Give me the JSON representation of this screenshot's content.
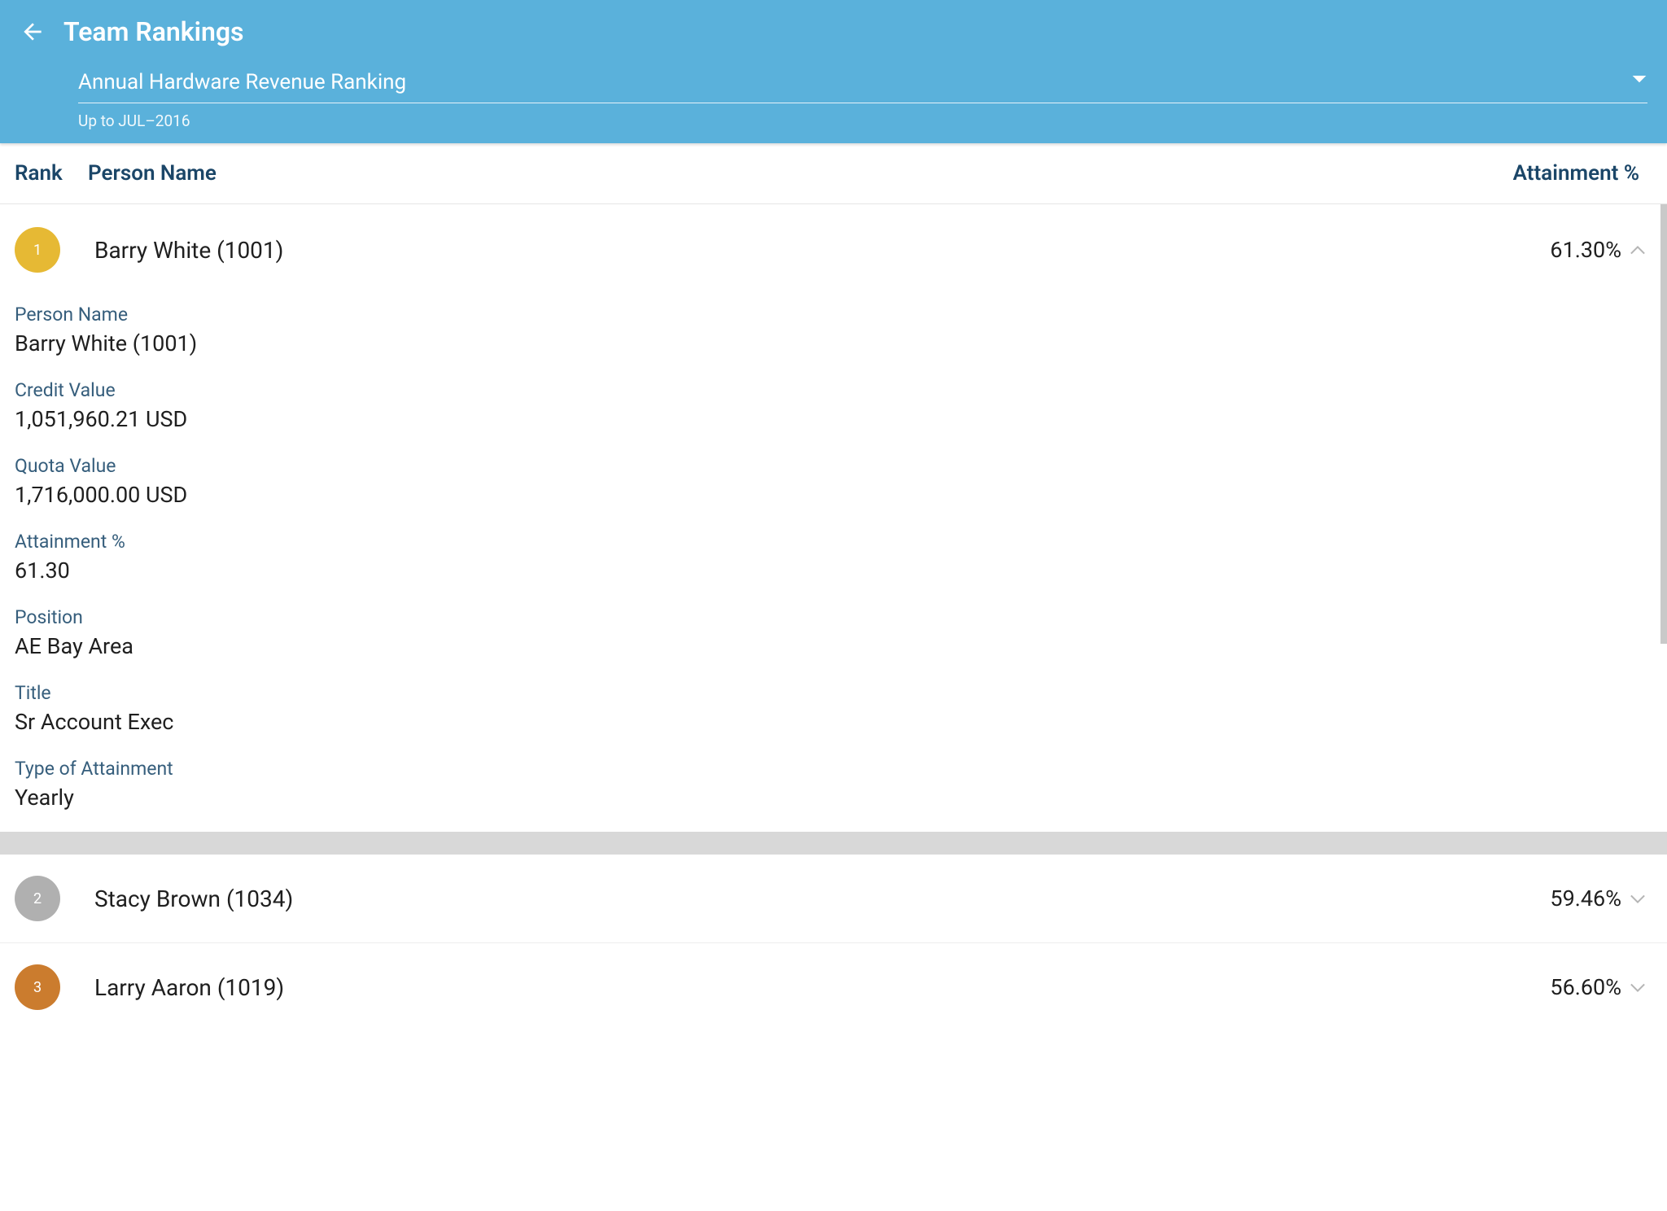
{
  "header": {
    "title": "Team Rankings",
    "dropdown_label": "Annual Hardware Revenue Ranking",
    "date_subtext": "Up to JUL–2016"
  },
  "columns": {
    "rank": "Rank",
    "name": "Person Name",
    "attain": "Attainment %"
  },
  "rows": [
    {
      "rank": "1",
      "badge_class": "badge-gold",
      "name": "Barry White (1001)",
      "attain": "61.30%",
      "expanded": true,
      "details": {
        "person_name_label": "Person Name",
        "person_name_value": "Barry White (1001)",
        "credit_label": "Credit Value",
        "credit_value": "1,051,960.21 USD",
        "quota_label": "Quota Value",
        "quota_value": "1,716,000.00 USD",
        "attain_label": "Attainment %",
        "attain_value": "61.30",
        "position_label": "Position",
        "position_value": "AE Bay Area",
        "title_label": "Title",
        "title_value": "Sr Account Exec",
        "type_label": "Type of Attainment",
        "type_value": "Yearly"
      }
    },
    {
      "rank": "2",
      "badge_class": "badge-silver",
      "name": "Stacy Brown (1034)",
      "attain": "59.46%",
      "expanded": false
    },
    {
      "rank": "3",
      "badge_class": "badge-bronze",
      "name": "Larry Aaron (1019)",
      "attain": "56.60%",
      "expanded": false
    }
  ]
}
